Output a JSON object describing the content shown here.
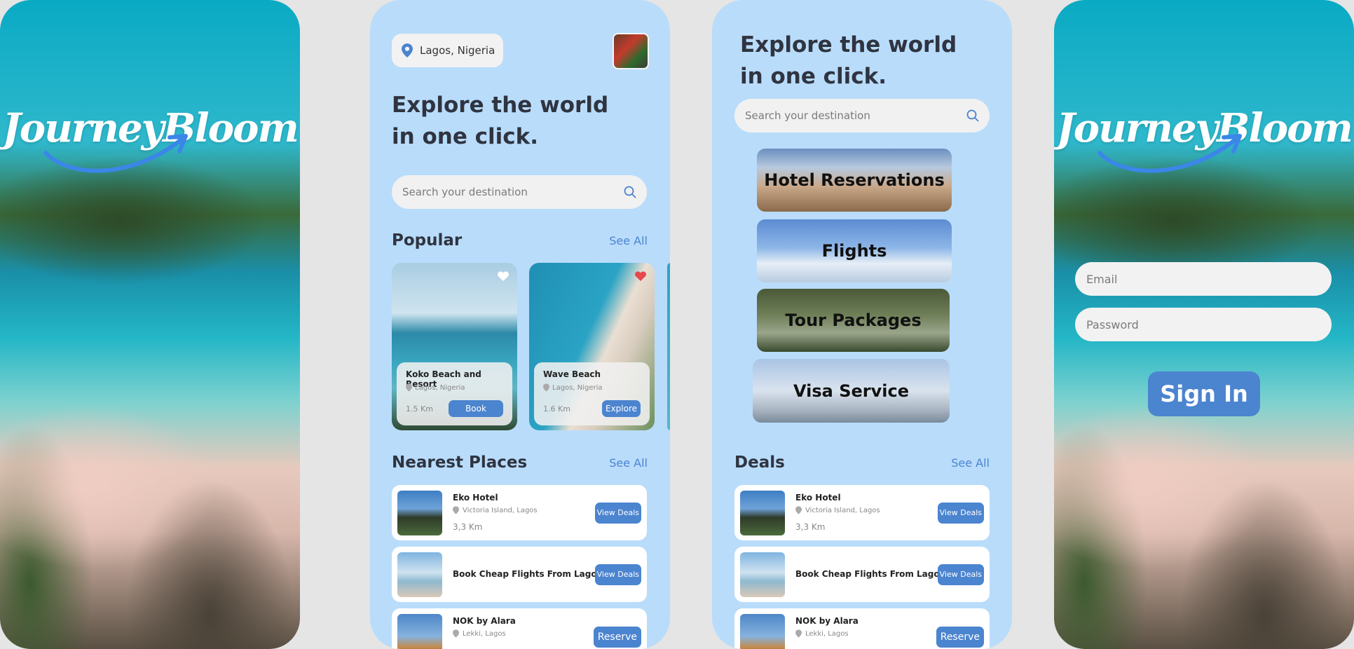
{
  "brand": {
    "logo_text": "JourneyBloom"
  },
  "colors": {
    "accent": "#4b84cf",
    "panel_bg": "#b9dcfb",
    "heart_active": "#e5484d"
  },
  "home": {
    "location": "Lagos, Nigeria",
    "headline": "Explore the world in one click.",
    "search_placeholder": "Search your destination",
    "popular": {
      "title": "Popular",
      "see_all": "See All",
      "cards": [
        {
          "title": "Koko Beach and Resort",
          "location": "Lagos, Nigeria",
          "distance": "1.5 Km",
          "action": "Book",
          "favorited": false
        },
        {
          "title": "Wave Beach",
          "location": "Lagos, Nigeria",
          "distance": "1.6 Km",
          "action": "Explore",
          "favorited": true
        }
      ]
    },
    "nearest": {
      "title": "Nearest Places",
      "see_all": "See All",
      "items": [
        {
          "title": "Eko Hotel",
          "location": "Victoria Island, Lagos",
          "distance": "3,3 Km",
          "action": "View Deals"
        },
        {
          "title": "Book Cheap Flights From Lagos",
          "action": "View Deals"
        },
        {
          "title": "NOK by Alara",
          "location": "Lekki, Lagos",
          "action": "Reserve"
        }
      ]
    }
  },
  "services": {
    "headline": "Explore the world in one click.",
    "search_placeholder": "Search your destination",
    "tiles": [
      "Hotel Reservations",
      "Flights",
      "Tour Packages",
      "Visa Service"
    ],
    "deals": {
      "title": "Deals",
      "see_all": "See All",
      "items": [
        {
          "title": "Eko Hotel",
          "location": "Victoria Island, Lagos",
          "distance": "3,3 Km",
          "action": "View Deals"
        },
        {
          "title": "Book Cheap Flights From Lagos",
          "action": "View Deals"
        },
        {
          "title": "NOK by Alara",
          "location": "Lekki, Lagos",
          "action": "Reserve"
        }
      ]
    }
  },
  "login": {
    "email_placeholder": "Email",
    "password_placeholder": "Password",
    "signin_label": "Sign In"
  },
  "icons": [
    "location-pin-icon",
    "search-icon",
    "heart-icon",
    "swoosh-arrow-icon"
  ]
}
